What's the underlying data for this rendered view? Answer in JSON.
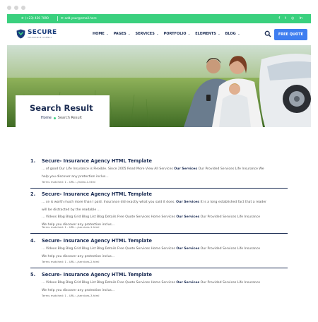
{
  "topbar": {
    "phone": "(+23) 456 7890",
    "email": "add.your@email.here",
    "social_icons": [
      "facebook-icon",
      "twitter-icon",
      "instagram-icon",
      "linkedin-icon"
    ],
    "social_glyphs": [
      "f",
      "t",
      "◎",
      "in"
    ],
    "color": "#3ad07e"
  },
  "header": {
    "logo_name": "SECURE",
    "logo_tagline": "INSURANCE AGENCY",
    "nav": [
      {
        "label": "HOME"
      },
      {
        "label": "PAGES"
      },
      {
        "label": "SERVICES"
      },
      {
        "label": "PORTFOLIO"
      },
      {
        "label": "ELEMENTS"
      },
      {
        "label": "BLOG"
      }
    ],
    "quote_label": "FREE QUOTE",
    "quote_color": "#3f7ef0"
  },
  "banner": {
    "title": "Search Result",
    "breadcrumb_home": "Home",
    "breadcrumb_current": "Search Result"
  },
  "results": [
    {
      "number": "1.",
      "title": "Secure- Insurance Agency HTML Template",
      "lines": [
        [
          "... of good Our Life Insurance is Flexible. Since 2005 Read More View All Services ",
          {
            "b": "Our Services"
          },
          " Our Provided Services Life Insurance We"
        ],
        [
          "help you discover any protection inclus..."
        ]
      ],
      "meta": "Terms matched: 1 - URL: ./index-1.html"
    },
    {
      "number": "2.",
      "title": "Secure- Insurance Agency HTML Template",
      "lines": [
        [
          "... ce is worth much more than I paid. Insurance did exactly what you said it does. ",
          {
            "b": "Our Services"
          },
          " It is a long established fact that a reader"
        ],
        [
          "will be distracted by the readable ..."
        ],
        [
          "... Videos Blog Blog Grid Blog List Blog Details Free Quote Services Home Services ",
          {
            "b": "Our Services"
          },
          " Our Provided Services Life Insurance"
        ],
        [
          "We help you discover any protection inclus..."
        ]
      ],
      "meta": "Terms matched: 1 - URL: ./services-1.html"
    },
    {
      "number": "4.",
      "title": "Secure- Insurance Agency HTML Template",
      "lines": [
        [
          "... Videos Blog Blog Grid Blog List Blog Details Free Quote Services Home Services ",
          {
            "b": "Our Services"
          },
          " Our Provided Services Life Insurance"
        ],
        [
          "We help you discover any protection inclus..."
        ]
      ],
      "meta": "Terms matched: 1 - URL: ./services-2.html"
    },
    {
      "number": "5.",
      "title": "Secure- Insurance Agency HTML Template",
      "lines": [
        [
          "... Videos Blog Blog Grid Blog List Blog Details Free Quote Services Home Services ",
          {
            "b": "Our Services"
          },
          " Our Provided Services Life Insurance"
        ],
        [
          "We help you discover any protection inclus..."
        ]
      ],
      "meta": "Terms matched: 1 - URL: ./services-3.html"
    }
  ]
}
